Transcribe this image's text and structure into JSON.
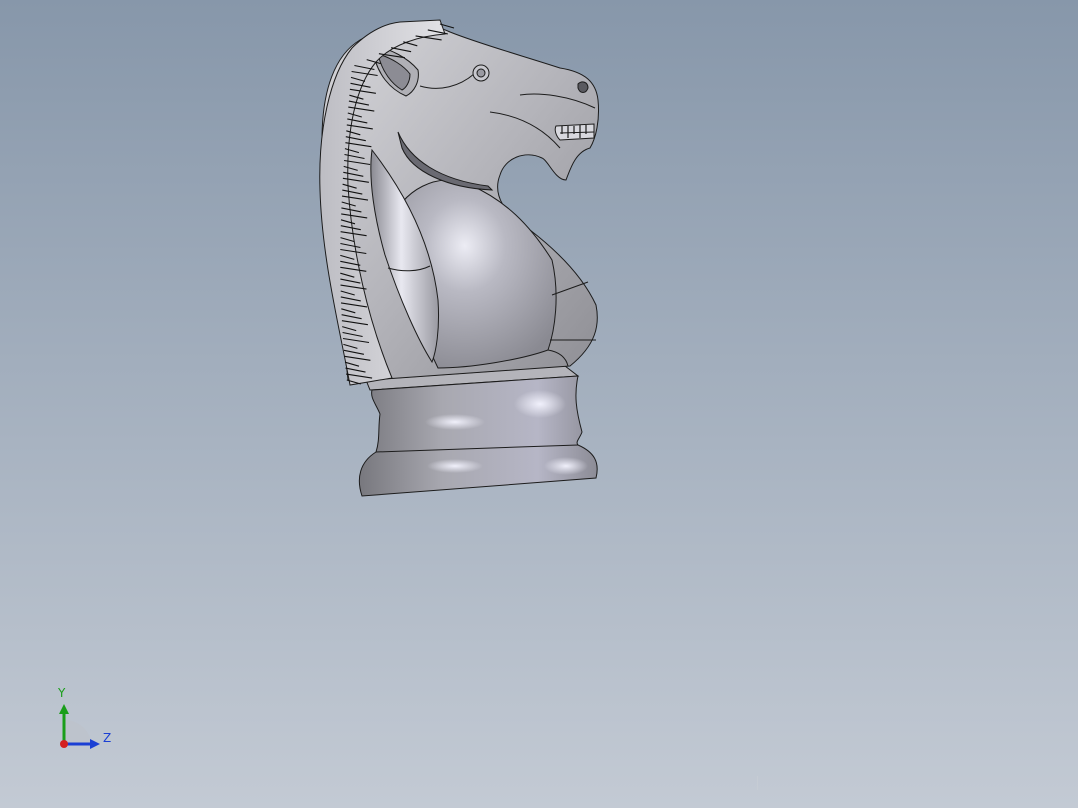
{
  "viewport": {
    "background_top": "#8797aa",
    "background_bottom": "#c3cad4"
  },
  "model": {
    "part": "chess-knight",
    "face_color": "#a3a3a8",
    "highlight_color": "#e4e4ee",
    "edge_color": "#1c1c1c"
  },
  "triad": {
    "y_label": "Y",
    "z_label": "Z",
    "y_color": "#1a9e1a",
    "z_color": "#1a3fd4",
    "x_color": "#d42020"
  }
}
